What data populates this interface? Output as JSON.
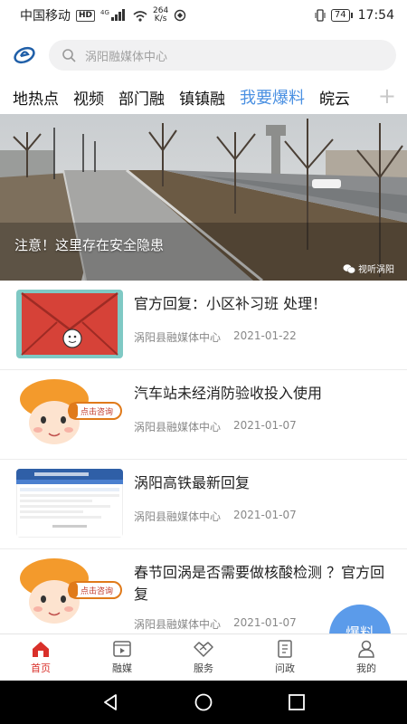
{
  "status_bar": {
    "carrier": "中国移动",
    "hd": "HD",
    "network": "4G",
    "speed_value": "264",
    "speed_unit": "K/s",
    "battery": "74",
    "time": "17:54"
  },
  "search": {
    "placeholder": "涡阳融媒体中心"
  },
  "tabs": [
    "地热点",
    "视频",
    "部门融",
    "镇镇融",
    "我要爆料",
    "皖云"
  ],
  "active_tab": "我要爆料",
  "banner": {
    "caption": "注意！这里存在安全隐患",
    "source": "视听涡阳"
  },
  "news": [
    {
      "title": "官方回复：小区补习班 处理！",
      "source": "涡阳县融媒体中心",
      "date": "2021-01-22",
      "thumb": "envelope"
    },
    {
      "title": "汽车站未经消防验收投入使用",
      "source": "涡阳县融媒体中心",
      "date": "2021-01-07",
      "thumb": "consult-girl"
    },
    {
      "title": "涡阳高铁最新回复",
      "source": "涡阳县融媒体中心",
      "date": "2021-01-07",
      "thumb": "webpage"
    },
    {
      "title": "春节回涡是否需要做核酸检测 ？官方回复",
      "source": "涡阳县融媒体中心",
      "date": "2021-01-07",
      "thumb": "consult-girl"
    }
  ],
  "consult_badge": "点击咨询",
  "fab_label": "爆料",
  "bottom_nav": [
    {
      "label": "首页",
      "icon": "home-icon",
      "active": true
    },
    {
      "label": "融媒",
      "icon": "video-icon",
      "active": false
    },
    {
      "label": "服务",
      "icon": "handshake-icon",
      "active": false
    },
    {
      "label": "问政",
      "icon": "document-icon",
      "active": false
    },
    {
      "label": "我的",
      "icon": "user-icon",
      "active": false
    }
  ],
  "colors": {
    "accent": "#4a90e2",
    "nav_active": "#d9302a",
    "fab": "#5b9bea"
  }
}
